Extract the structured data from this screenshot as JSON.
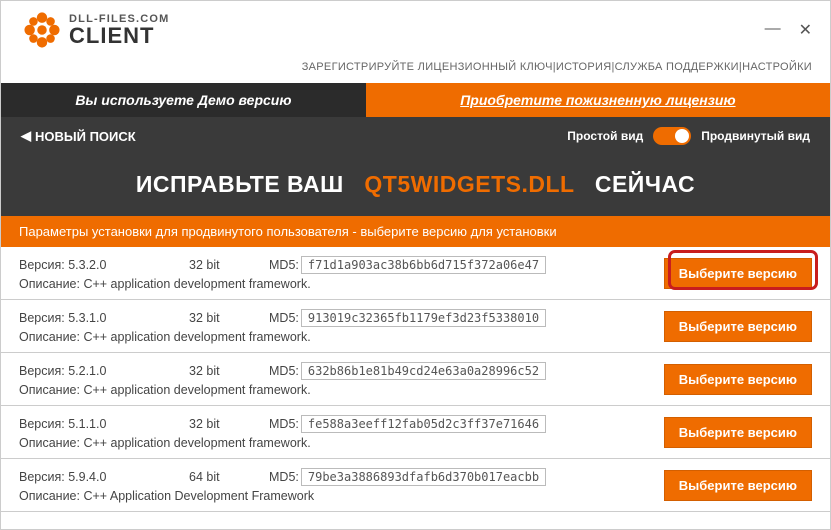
{
  "logo": {
    "site": "DLL-FILES.COM",
    "client": "CLIENT"
  },
  "menu": {
    "register": "ЗАРЕГИСТРИРУЙТЕ ЛИЦЕНЗИОННЫЙ КЛЮЧ",
    "history": "ИСТОРИЯ",
    "support": "СЛУЖБА ПОДДЕРЖКИ",
    "settings": "НАСТРОЙКИ",
    "sep": " | "
  },
  "windowControls": {
    "minimize": "—",
    "close": "✕"
  },
  "promo": {
    "left": "Вы используете Демо версию",
    "right": "Приобретите пожизненную лицензию"
  },
  "subheader": {
    "back_icon": "◀",
    "back": "НОВЫЙ ПОИСК",
    "simpleView": "Простой вид",
    "advancedView": "Продвинутый вид"
  },
  "fixBanner": {
    "before": "ИСПРАВЬТЕ ВАШ",
    "dll": "QT5WIDGETS.DLL",
    "after": "СЕЙЧАС"
  },
  "paramsBar": "Параметры установки для продвинутого пользователя - выберите версию для установки",
  "labels": {
    "versionPrefix": "Версия: ",
    "md5Prefix": "MD5:",
    "descPrefix": "Описание: ",
    "selectBtn": "Выберите версию"
  },
  "versions": [
    {
      "version": "5.3.2.0",
      "arch": "32 bit",
      "md5": "f71d1a903ac38b6bb6d715f372a06e47",
      "desc": "C++ application development framework.",
      "highlighted": true
    },
    {
      "version": "5.3.1.0",
      "arch": "32 bit",
      "md5": "913019c32365fb1179ef3d23f5338010",
      "desc": "C++ application development framework.",
      "highlighted": false
    },
    {
      "version": "5.2.1.0",
      "arch": "32 bit",
      "md5": "632b86b1e81b49cd24e63a0a28996c52",
      "desc": "C++ application development framework.",
      "highlighted": false
    },
    {
      "version": "5.1.1.0",
      "arch": "32 bit",
      "md5": "fe588a3eeff12fab05d2c3ff37e71646",
      "desc": "C++ application development framework.",
      "highlighted": false
    },
    {
      "version": "5.9.4.0",
      "arch": "64 bit",
      "md5": "79be3a3886893dfafb6d370b017eacbb",
      "desc": "C++ Application Development Framework",
      "highlighted": false
    }
  ]
}
